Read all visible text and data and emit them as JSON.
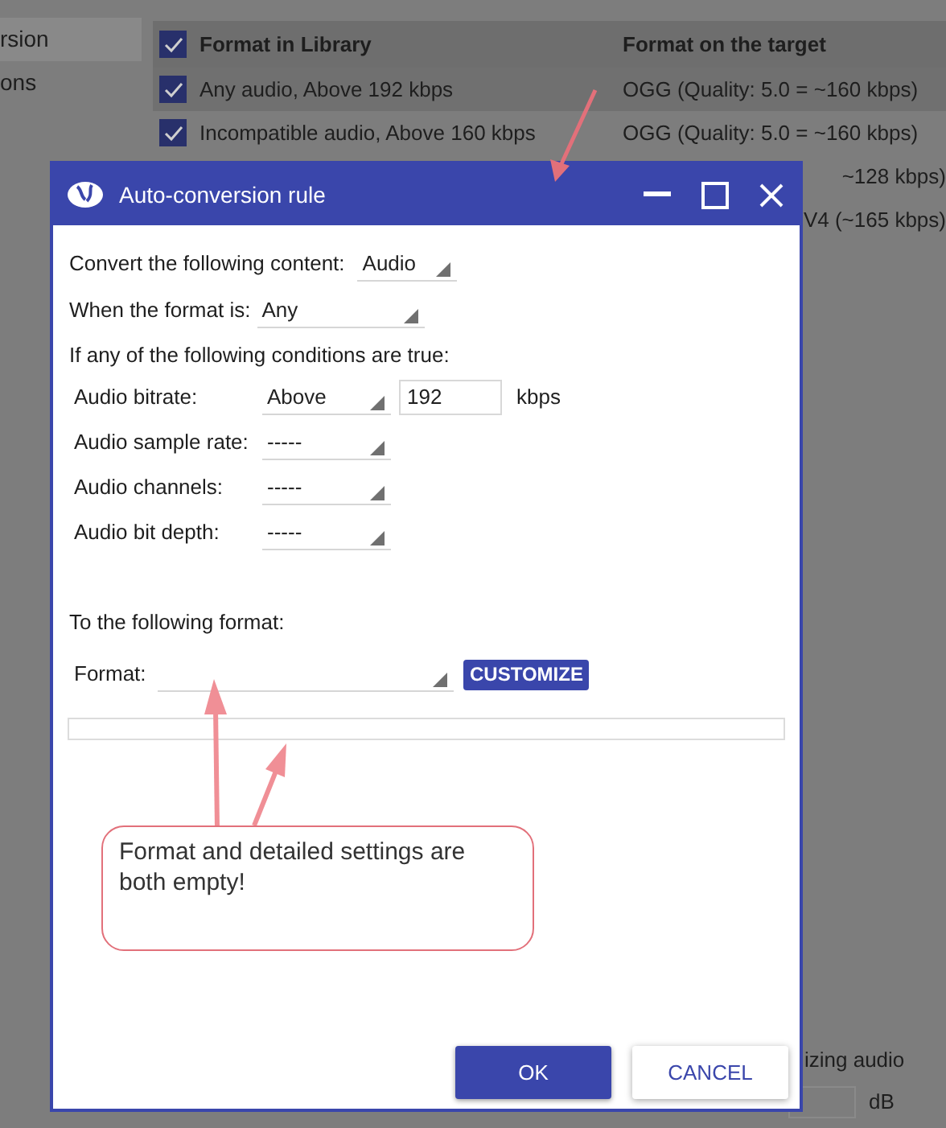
{
  "background": {
    "sidebar_items": [
      {
        "label": "rsion",
        "selected": true
      },
      {
        "label": "ons",
        "selected": false
      }
    ],
    "table": {
      "header_checked": true,
      "columns": [
        "Format in Library",
        "Format on the target"
      ],
      "rows": [
        {
          "checked": true,
          "source": "Any audio, Above 192 kbps",
          "target": "OGG (Quality: 5.0 = ~160 kbps)",
          "selected": true
        },
        {
          "checked": true,
          "source": "Incompatible audio, Above 160 kbps",
          "target": "OGG (Quality: 5.0 = ~160 kbps)",
          "selected": false
        },
        {
          "target": "~128 kbps)",
          "selected": false
        },
        {
          "target": "V4 (~165 kbps)",
          "selected": false
        }
      ]
    },
    "footer": {
      "label": "izing audio",
      "unit": "dB"
    }
  },
  "dialog": {
    "title": "Auto-conversion rule",
    "content": {
      "label": "Convert the following content:",
      "value": "Audio"
    },
    "format_is": {
      "label": "When the format is:",
      "value": "Any"
    },
    "conditions_heading": "If any of the following conditions are true:",
    "conditions": [
      {
        "label": "Audio bitrate:",
        "value": "Above",
        "amount": "192",
        "unit": "kbps"
      },
      {
        "label": "Audio sample rate:",
        "value": "-----"
      },
      {
        "label": "Audio channels:",
        "value": "-----"
      },
      {
        "label": "Audio bit depth:",
        "value": "-----"
      }
    ],
    "target_heading": "To the following format:",
    "format": {
      "label": "Format:"
    },
    "customize_button": "CUSTOMIZE",
    "buttons": [
      {
        "label": "OK",
        "kind": "primary"
      },
      {
        "label": "CANCEL",
        "kind": "secondary"
      }
    ]
  },
  "annotation": {
    "callout": "Format and detailed settings are both empty!"
  }
}
